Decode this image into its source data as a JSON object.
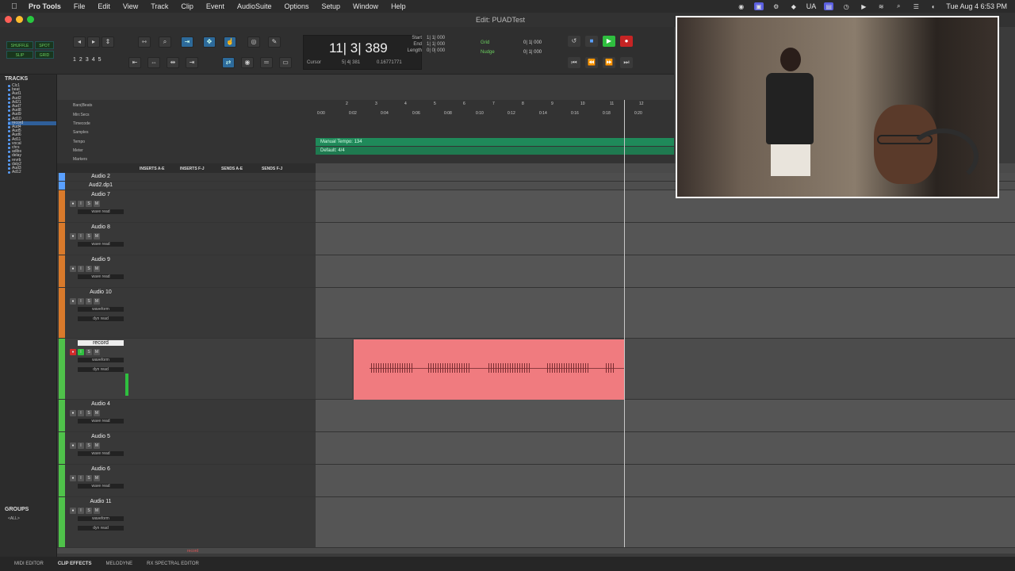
{
  "menubar": {
    "app": "Pro Tools",
    "menus": [
      "File",
      "Edit",
      "View",
      "Track",
      "Clip",
      "Event",
      "AudioSuite",
      "Options",
      "Setup",
      "Window",
      "Help"
    ],
    "right_text": "UA",
    "datetime": "Tue Aug 4  6:53 PM"
  },
  "window": {
    "title": "Edit: PUADTest"
  },
  "toolbar": {
    "modes": [
      "SHUFFLE",
      "SPOT",
      "SLIP",
      "GRID"
    ],
    "zoom_presets": [
      "1",
      "2",
      "3",
      "4",
      "5"
    ],
    "counter_main": "11| 3| 389",
    "cursor_label": "Cursor",
    "cursor_value": "5| 4| 381",
    "cursor_extra": "0.16771771",
    "selection": [
      {
        "key": "Start",
        "value": "1| 1| 000"
      },
      {
        "key": "End",
        "value": "1| 1| 000"
      },
      {
        "key": "Length",
        "value": "0| 0| 000"
      }
    ],
    "grid_label": "Grid",
    "grid_value": "0| 1| 000",
    "nudge_label": "Nudge",
    "nudge_value": "0| 1| 000"
  },
  "tracks_panel": {
    "title": "TRACKS",
    "items": [
      "Clc1",
      "beat",
      "Aud1",
      "Aud2",
      "Ad21",
      "Aud7",
      "Aud8",
      "Aud9",
      "Ad10",
      "record",
      "Aud4",
      "Aud5",
      "Aud6",
      "Ad11",
      "vocal",
      "chrs",
      "adlbs",
      "delay",
      "revrb",
      "daly2",
      "Aud3",
      "Ad12"
    ],
    "groups_title": "GROUPS",
    "groups_all": "<ALL>"
  },
  "rulers": {
    "labels": [
      "Bars|Beats",
      "Min:Secs",
      "Timecode",
      "Samples",
      "Tempo",
      "Meter",
      "Markers"
    ],
    "bars": [
      "2",
      "3",
      "4",
      "5",
      "6",
      "7",
      "8",
      "9",
      "10",
      "11",
      "12"
    ],
    "mins": [
      "0:00",
      "0:02",
      "0:04",
      "0:06",
      "0:08",
      "0:10",
      "0:12",
      "0:14",
      "0:16",
      "0:18",
      "0:20"
    ],
    "tempo_text": "Manual Tempo: 134",
    "meter_text": "Default: 4/4"
  },
  "columns": [
    "INSERTS A-E",
    "INSERTS F-J",
    "SENDS A-E",
    "SENDS F-J"
  ],
  "top_tracks": [
    "Audio 2",
    "Aud2.dp1"
  ],
  "tracks": [
    {
      "name": "Audio 7",
      "color": "#d97a2b",
      "view": "wave",
      "mode": "read"
    },
    {
      "name": "Audio 8",
      "color": "#d97a2b",
      "view": "wave",
      "mode": "read"
    },
    {
      "name": "Audio 9",
      "color": "#d97a2b",
      "view": "wave",
      "mode": "read"
    },
    {
      "name": "Audio 10",
      "color": "#d97a2b",
      "view": "waveform",
      "mode": "read",
      "dyn": "dyn"
    },
    {
      "name": "record",
      "color": "#4fc24a",
      "view": "waveform",
      "mode": "read",
      "dyn": "dyn"
    },
    {
      "name": "Audio 4",
      "color": "#4fc24a",
      "view": "wave",
      "mode": "read"
    },
    {
      "name": "Audio 5",
      "color": "#4fc24a",
      "view": "wave",
      "mode": "read"
    },
    {
      "name": "Audio 6",
      "color": "#4fc24a",
      "view": "wave",
      "mode": "read"
    },
    {
      "name": "Audio 11",
      "color": "#4fc24a",
      "view": "waveform",
      "mode": "read",
      "dyn": "dyn"
    }
  ],
  "btn_labels": {
    "i": "I",
    "s": "S",
    "m": "M"
  },
  "clip": {
    "color": "#f07b7f"
  },
  "bottom_tabs": [
    "MIDI EDITOR",
    "CLIP EFFECTS",
    "MELODYNE",
    "RX SPECTRAL EDITOR"
  ],
  "bottom_bottom_label": "record"
}
